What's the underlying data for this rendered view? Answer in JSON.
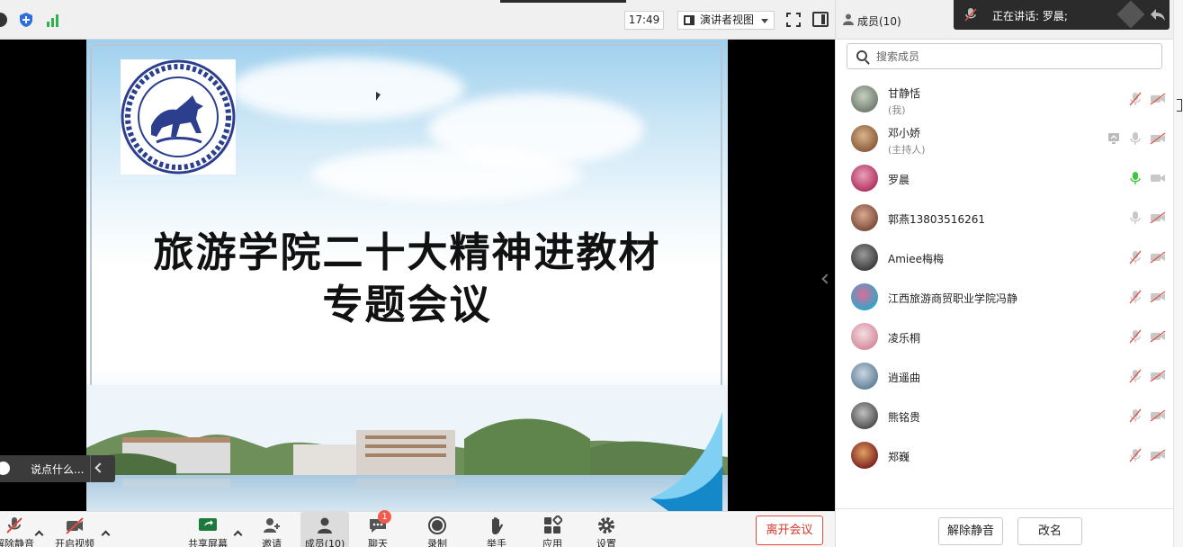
{
  "topbar": {
    "time": "17:49",
    "view_label": "演讲者视图",
    "icons": [
      "circle-icon",
      "shield-icon",
      "signal-icon",
      "fullscreen-icon",
      "sidebar-toggle-icon"
    ]
  },
  "slide": {
    "title_line1": "旅游学院二十大精神进教材",
    "title_line2": "专题会议",
    "logo_text": "江西旅游商贸职业学院"
  },
  "chat_input": {
    "placeholder": "说点什么..."
  },
  "toolbar": {
    "items": [
      {
        "label": "解除静音",
        "icon": "mic-muted-icon"
      },
      {
        "label": "开启视频",
        "icon": "video-off-icon"
      },
      {
        "label": "共享屏幕",
        "icon": "share-screen-icon"
      },
      {
        "label": "邀请",
        "icon": "invite-icon"
      },
      {
        "label": "成员(10)",
        "icon": "members-icon"
      },
      {
        "label": "聊天",
        "icon": "chat-icon",
        "badge": "1"
      },
      {
        "label": "录制",
        "icon": "record-icon"
      },
      {
        "label": "举手",
        "icon": "raise-hand-icon"
      },
      {
        "label": "应用",
        "icon": "apps-icon"
      },
      {
        "label": "设置",
        "icon": "settings-icon"
      }
    ],
    "leave_label": "离开会议"
  },
  "panel": {
    "title": "成员(10)",
    "search_placeholder": "搜索成员",
    "members": [
      {
        "name": "甘静恬",
        "role": "(我)",
        "mic": "muted",
        "cam": "off"
      },
      {
        "name": "邓小娇",
        "role": "(主持人)",
        "mic": "on",
        "cam": "off",
        "sharing": true
      },
      {
        "name": "罗晨",
        "role": "",
        "mic": "speaking",
        "cam": "on"
      },
      {
        "name": "郭燕13803516261",
        "role": "",
        "mic": "on",
        "cam": "off"
      },
      {
        "name": "Amiee梅梅",
        "role": "",
        "mic": "muted",
        "cam": "off"
      },
      {
        "name": "江西旅游商贸职业学院冯静",
        "role": "",
        "mic": "muted",
        "cam": "off"
      },
      {
        "name": "凌乐桐",
        "role": "",
        "mic": "muted",
        "cam": "off"
      },
      {
        "name": "逍遥曲",
        "role": "",
        "mic": "muted",
        "cam": "off"
      },
      {
        "name": "熊铭贵",
        "role": "",
        "mic": "muted",
        "cam": "off"
      },
      {
        "name": "郑巍",
        "role": "",
        "mic": "muted",
        "cam": "off"
      }
    ],
    "unmute_all_label": "解除静音",
    "rename_label": "改名"
  },
  "speaking": {
    "text": "正在讲话: 罗晨;"
  },
  "colors": {
    "accent_red": "#e24c3e",
    "speaking_green": "#3cc83c",
    "muted_red": "#e05a4a"
  }
}
